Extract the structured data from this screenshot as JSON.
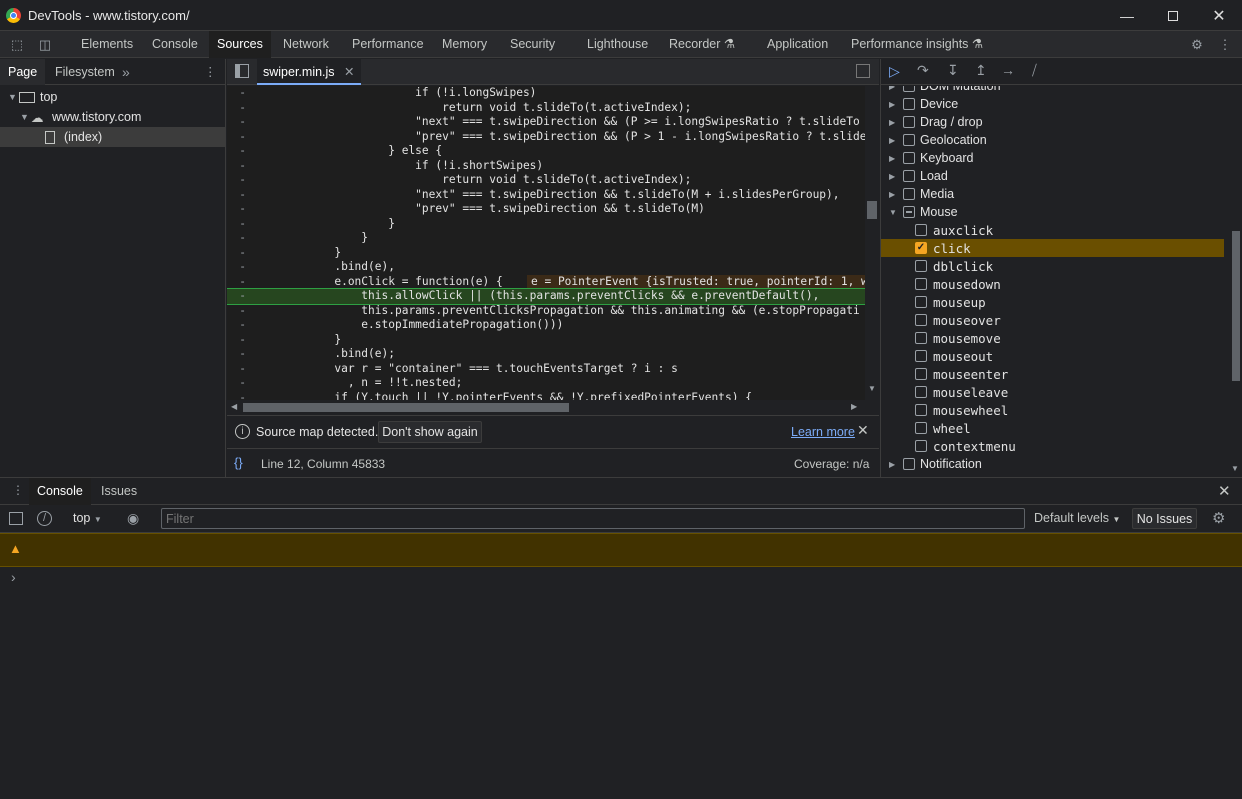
{
  "window": {
    "title": "DevTools - www.tistory.com/",
    "min_icon": "minimize-icon",
    "max_icon": "maximize-icon",
    "close_icon": "close-icon"
  },
  "main_tabs": [
    "Elements",
    "Console",
    "Sources",
    "Network",
    "Performance",
    "Memory",
    "Security",
    "Lighthouse",
    "Recorder",
    "Application",
    "Performance insights"
  ],
  "navigator": {
    "tabs": [
      "Page",
      "Filesystem"
    ],
    "tree": [
      "top",
      "www.tistory.com",
      "(index)"
    ]
  },
  "editor": {
    "file_tab": "swiper.min.js",
    "source_map": {
      "text": "Source map detected.",
      "dont_show": "Don't show again",
      "learn_more": "Learn more"
    },
    "status": {
      "position": "Line 12, Column 45833",
      "coverage": "Coverage: n/a"
    }
  },
  "code_lines": [
    "                      if (!i.longSwipes)",
    "                          return void t.slideTo(t.activeIndex);",
    "                      \"next\" === t.swipeDirection && (P >= i.longSwipesRatio ? t.slideTo",
    "                      \"prev\" === t.swipeDirection && (P > 1 - i.longSwipesRatio ? t.slide",
    "                  } else {",
    "                      if (!i.shortSwipes)",
    "                          return void t.slideTo(t.activeIndex);",
    "                      \"next\" === t.swipeDirection && t.slideTo(M + i.slidesPerGroup),",
    "                      \"prev\" === t.swipeDirection && t.slideTo(M)",
    "                  }",
    "              }",
    "          }",
    "          .bind(e),",
    "          e.onClick = function(e) {",
    "              this.allowClick || (this.params.preventClicks && e.preventDefault(),",
    "              this.params.preventClicksPropagation && this.animating && (e.stopPropagati",
    "              e.stopImmediatePropagation()))",
    "          }",
    "          .bind(e);",
    "          var r = \"container\" === t.touchEventsTarget ? i : s",
    "            , n = !!t.nested;",
    "          if (Y.touch || !Y.pointerEvents && !Y.prefixedPointerEvents) {"
  ],
  "inline_value": "e = PointerEvent {isTrusted: true, pointerId: 1, w",
  "breakpoints": {
    "categories": [
      {
        "label": "DOM Mutation",
        "expanded": false
      },
      {
        "label": "Device",
        "expanded": false
      },
      {
        "label": "Drag / drop",
        "expanded": false
      },
      {
        "label": "Geolocation",
        "expanded": false
      },
      {
        "label": "Keyboard",
        "expanded": false
      },
      {
        "label": "Load",
        "expanded": false
      },
      {
        "label": "Media",
        "expanded": false
      },
      {
        "label": "Mouse",
        "expanded": true
      }
    ],
    "mouse_events": [
      {
        "label": "auxclick",
        "checked": false
      },
      {
        "label": "click",
        "checked": true
      },
      {
        "label": "dblclick",
        "checked": false
      },
      {
        "label": "mousedown",
        "checked": false
      },
      {
        "label": "mouseup",
        "checked": false
      },
      {
        "label": "mouseover",
        "checked": false
      },
      {
        "label": "mousemove",
        "checked": false
      },
      {
        "label": "mouseout",
        "checked": false
      },
      {
        "label": "mouseenter",
        "checked": false
      },
      {
        "label": "mouseleave",
        "checked": false
      },
      {
        "label": "mousewheel",
        "checked": false
      },
      {
        "label": "wheel",
        "checked": false
      },
      {
        "label": "contextmenu",
        "checked": false
      }
    ],
    "after": {
      "label": "Notification",
      "expanded": false
    }
  },
  "drawer": {
    "tabs": [
      "Console",
      "Issues"
    ],
    "context": "top",
    "filter_placeholder": "Filter",
    "levels": "Default levels",
    "issues": "No Issues",
    "prompt": "›"
  },
  "colors": {
    "accent": "#7cacf8",
    "warning_bg": "#413200",
    "exec_line": "#26461f",
    "checked": "#f5a623"
  }
}
